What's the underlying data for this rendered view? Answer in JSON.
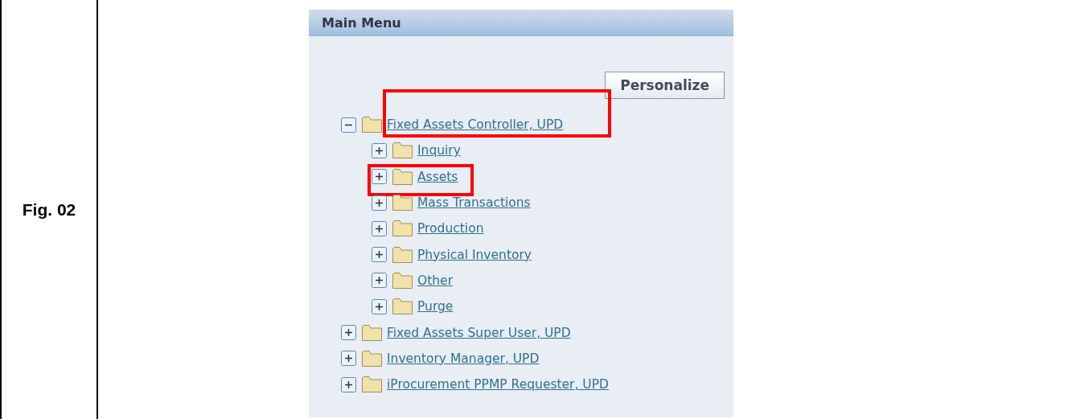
{
  "figure_label": "Fig. 02",
  "panel": {
    "title": "Main Menu",
    "button": "Personalize"
  },
  "tree": [
    {
      "label": "Fixed Assets Controller, UPD",
      "expanded": true,
      "highlighted": true,
      "children": [
        {
          "label": "Inquiry",
          "expanded": false,
          "highlighted": false
        },
        {
          "label": "Assets",
          "expanded": false,
          "highlighted": true
        },
        {
          "label": "Mass Transactions",
          "expanded": false,
          "highlighted": false
        },
        {
          "label": "Production",
          "expanded": false,
          "highlighted": false
        },
        {
          "label": "Physical Inventory",
          "expanded": false,
          "highlighted": false
        },
        {
          "label": "Other",
          "expanded": false,
          "highlighted": false
        },
        {
          "label": "Purge",
          "expanded": false,
          "highlighted": false
        }
      ]
    },
    {
      "label": "Fixed Assets Super User, UPD",
      "expanded": false,
      "highlighted": false
    },
    {
      "label": "Inventory Manager, UPD",
      "expanded": false,
      "highlighted": false
    },
    {
      "label": "iProcurement PPMP Requester, UPD",
      "expanded": false,
      "highlighted": false
    }
  ]
}
